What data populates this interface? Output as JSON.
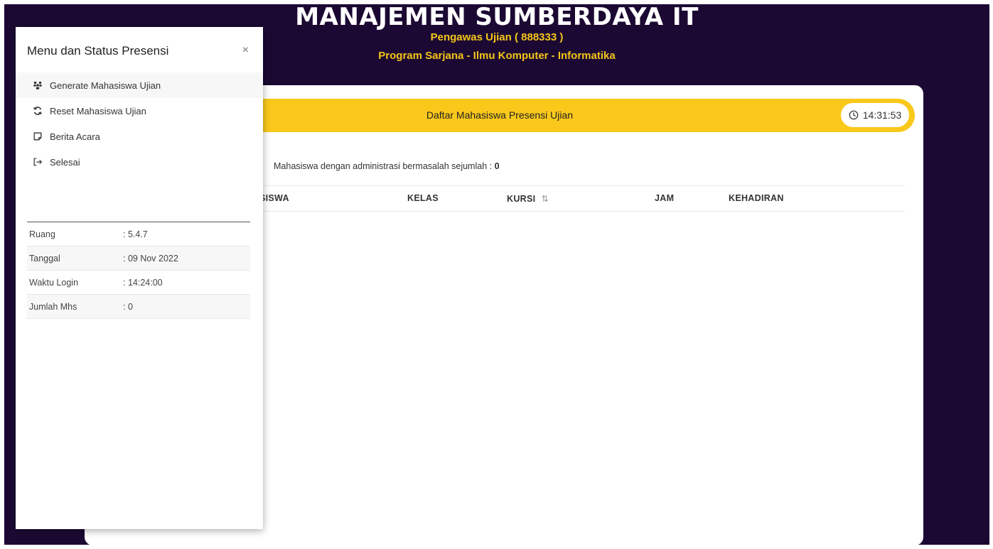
{
  "header": {
    "title": "MANAJEMEN SUMBERDAYA IT",
    "role_line": "Pengawas Ujian ( 888333 )",
    "program_line": "Program Sarjana - Ilmu Komputer - Informatika"
  },
  "main": {
    "bar_title": "Daftar Mahasiswa Presensi Ujian",
    "clock_time": "14:31:53",
    "admin_label": "Mahasiswa dengan administrasi bermasalah sejumlah :",
    "admin_count": "0",
    "table_headers": [
      "SISWA",
      "KELAS",
      "KURSI",
      "JAM",
      "KEHADIRAN"
    ],
    "sort_icon": "⇅"
  },
  "panel": {
    "title": "Menu dan Status Presensi",
    "close_glyph": "×",
    "menu": [
      {
        "label": "Generate Mahasiswa Ujian",
        "icon": "users-icon"
      },
      {
        "label": "Reset Mahasiswa Ujian",
        "icon": "refresh-icon"
      },
      {
        "label": "Berita Acara",
        "icon": "note-icon"
      },
      {
        "label": "Selesai",
        "icon": "logout-icon"
      }
    ],
    "info": [
      {
        "key": "Ruang",
        "value": ": 5.4.7"
      },
      {
        "key": "Tanggal",
        "value": ": 09 Nov 2022"
      },
      {
        "key": "Waktu Login",
        "value": ": 14:24:00"
      },
      {
        "key": "Jumlah Mhs",
        "value": ": 0"
      }
    ]
  },
  "colors": {
    "background": "#1b0933",
    "accent_yellow": "#f9c81b",
    "subtitle_yellow": "#f5c518"
  }
}
